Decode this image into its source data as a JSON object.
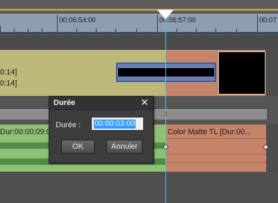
{
  "ruler": {
    "time_labels": [
      "00:06:54:00",
      "00:06:57:00",
      "00:07"
    ]
  },
  "tracks": {
    "upper_clip_times": [
      "0:14]",
      "0:14]"
    ],
    "lower_left_clip_label": "Dur:00:00:09:0",
    "lower_right_clip_label": "Color Matte  TL [Dur:00..."
  },
  "dialog": {
    "title": "Durée",
    "close_symbol": "✕",
    "duration_label": "Durée :",
    "duration_value": "00:00:03:00",
    "ok_label": "OK",
    "cancel_label": "Annuler"
  },
  "colors": {
    "playhead_line": "#54c8e8",
    "selection": "#3399ff",
    "clip_yellow": "#bdb779",
    "clip_orange": "#c5846a",
    "clip_green": "#8fbf73"
  }
}
